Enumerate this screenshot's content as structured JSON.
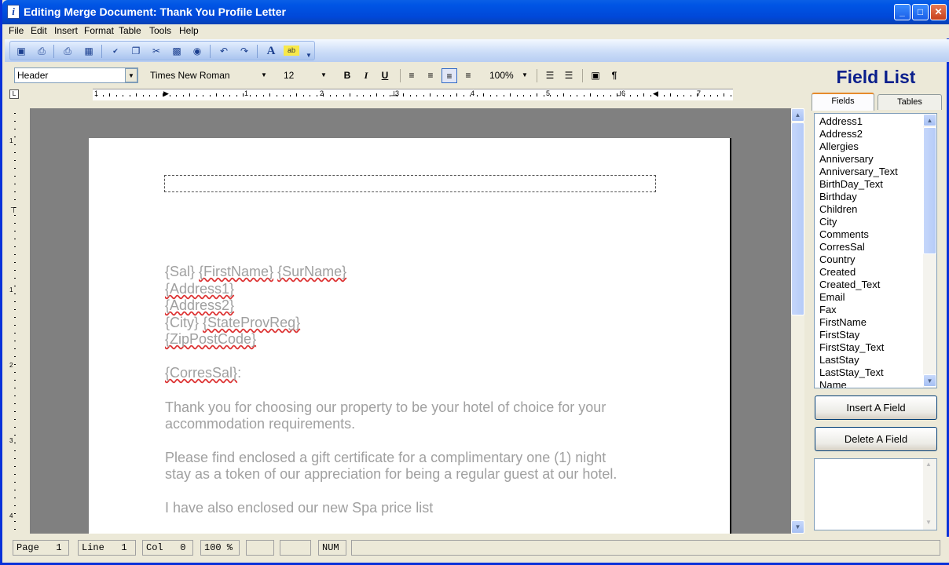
{
  "window": {
    "title": "Editing Merge Document: Thank You Profile Letter",
    "app_icon": "i",
    "minimize": "_",
    "maximize": "□",
    "close": "✕"
  },
  "menu": [
    "File",
    "Edit",
    "Insert",
    "Format",
    "Table",
    "Tools",
    "Help"
  ],
  "toolbar1": {
    "icons": [
      "save-icon",
      "print-preview-icon",
      "print-icon",
      "preview-icon",
      "spellcheck-icon",
      "copy-icon",
      "cut-icon",
      "paste-icon",
      "find-icon",
      "undo-icon",
      "redo-icon",
      "font-icon",
      "highlight-icon",
      "overflow-icon"
    ]
  },
  "format_bar": {
    "style": "Header",
    "font": "Times New Roman",
    "size": "12",
    "zoom": "100%",
    "bold": "B",
    "italic": "I",
    "underline": "U"
  },
  "ruler": {
    "labels": [
      "1",
      "1",
      "2",
      "3",
      "4",
      "5",
      "6",
      "7"
    ]
  },
  "document": {
    "address_lines": [
      "{Sal} {FirstName} {SurName}",
      "{Address1}",
      "{Address2}",
      "{City} {StateProvReg}",
      "{ZipPostCode}"
    ],
    "salutation": "{CorresSal}:",
    "para1": [
      "Thank you for choosing our property to be your hotel of choice for your",
      "accommodation requirements."
    ],
    "para2": [
      "Please find enclosed a gift certificate for a complimentary one (1) night",
      "stay as a token of our appreciation for being a regular guest at our hotel."
    ],
    "para3": "I have also enclosed our new Spa price list"
  },
  "panel": {
    "title": "Field List",
    "tabs": [
      "Fields",
      "Tables"
    ],
    "fields": [
      "Address1",
      "Address2",
      "Allergies",
      "Anniversary",
      "Anniversary_Text",
      "BirthDay_Text",
      "Birthday",
      "Children",
      "City",
      "Comments",
      "CorresSal",
      "Country",
      "Created",
      "Created_Text",
      "Email",
      "Fax",
      "FirstName",
      "FirstStay",
      "FirstStay_Text",
      "LastStay",
      "LastStay_Text",
      "Name"
    ],
    "insert_button": "Insert A Field",
    "delete_button": "Delete A Field"
  },
  "status": {
    "page": "Page   1",
    "line": "Line   1",
    "col": "Col   0",
    "zoom": "100 %",
    "num": "NUM"
  }
}
